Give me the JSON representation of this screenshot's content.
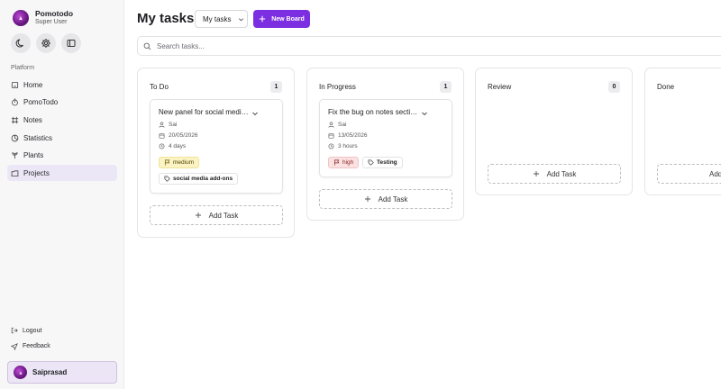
{
  "app": {
    "name": "Pomotodo",
    "role": "Super User"
  },
  "sidebar": {
    "section_label": "Platform",
    "items": [
      {
        "label": "Home",
        "icon": "home-icon"
      },
      {
        "label": "PomoTodo",
        "icon": "timer-icon"
      },
      {
        "label": "Notes",
        "icon": "notes-icon"
      },
      {
        "label": "Statistics",
        "icon": "statistics-icon"
      },
      {
        "label": "Plants",
        "icon": "plant-icon"
      },
      {
        "label": "Projects",
        "icon": "projects-icon",
        "active": true
      }
    ],
    "bottom": [
      {
        "label": "Logout",
        "icon": "logout-icon"
      },
      {
        "label": "Feedback",
        "icon": "feedback-icon"
      }
    ],
    "user": {
      "name": "Saiprasad"
    }
  },
  "header": {
    "title": "My tasks",
    "board_select": "My tasks",
    "new_board": "New Board"
  },
  "search": {
    "placeholder": "Search tasks..."
  },
  "columns": [
    {
      "title": "To Do",
      "count": "1",
      "cards": [
        {
          "title": "New panel for social media add-ons",
          "assignee": "Sai",
          "date": "20/05/2026",
          "duration": "4 days",
          "priority": "medium",
          "tag": "social media add-ons"
        }
      ],
      "add_label": "Add Task"
    },
    {
      "title": "In Progress",
      "count": "1",
      "cards": [
        {
          "title": "Fix the bug on notes section",
          "assignee": "Sai",
          "date": "13/05/2026",
          "duration": "3 hours",
          "priority": "high",
          "tag": "Testing"
        }
      ],
      "add_label": "Add Task"
    },
    {
      "title": "Review",
      "count": "0",
      "cards": [],
      "add_label": "Add Task"
    },
    {
      "title": "Done",
      "count": "",
      "cards": [],
      "add_label": "Add Task"
    }
  ],
  "colors": {
    "accent": "#7c2fe0",
    "active_nav": "#ece7f6",
    "medium": "#fcf3c4",
    "high": "#fbe2e2"
  }
}
